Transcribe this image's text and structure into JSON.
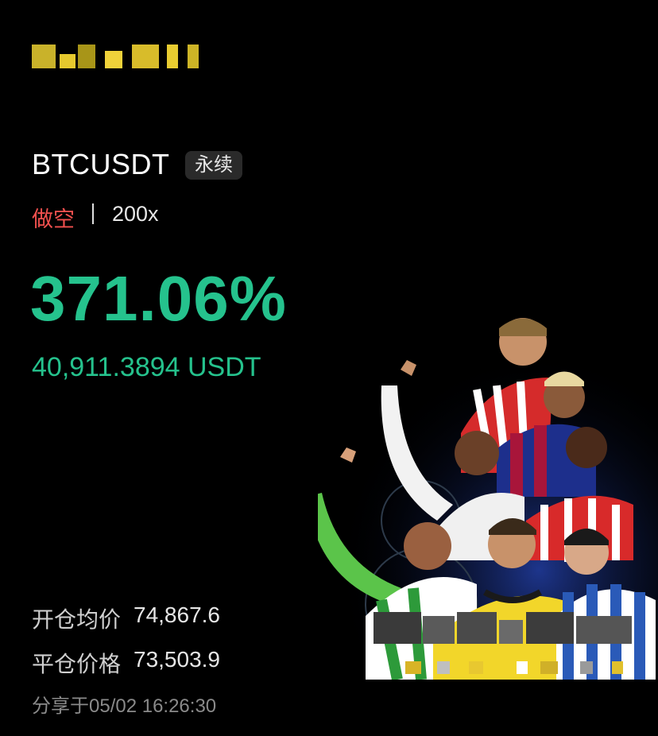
{
  "app": {
    "logo_icon": "pixelated-exchange-logo"
  },
  "position": {
    "pair": "BTCUSDT",
    "contract_tag": "永续",
    "direction": "做空",
    "leverage": "200x",
    "roi": "371.06%",
    "pnl": "40,911.3894 USDT"
  },
  "prices": {
    "open_label": "开仓均价",
    "open_value": "74,867.6",
    "close_label": "平仓价格",
    "close_value": "73,503.9"
  },
  "footer": {
    "shared_at": "分享于05/02 16:26:30"
  },
  "promo": {
    "image_icon": "football-players-promo-image"
  },
  "colors": {
    "profit": "#25c28d",
    "short": "#f0504e",
    "background": "#000000"
  }
}
